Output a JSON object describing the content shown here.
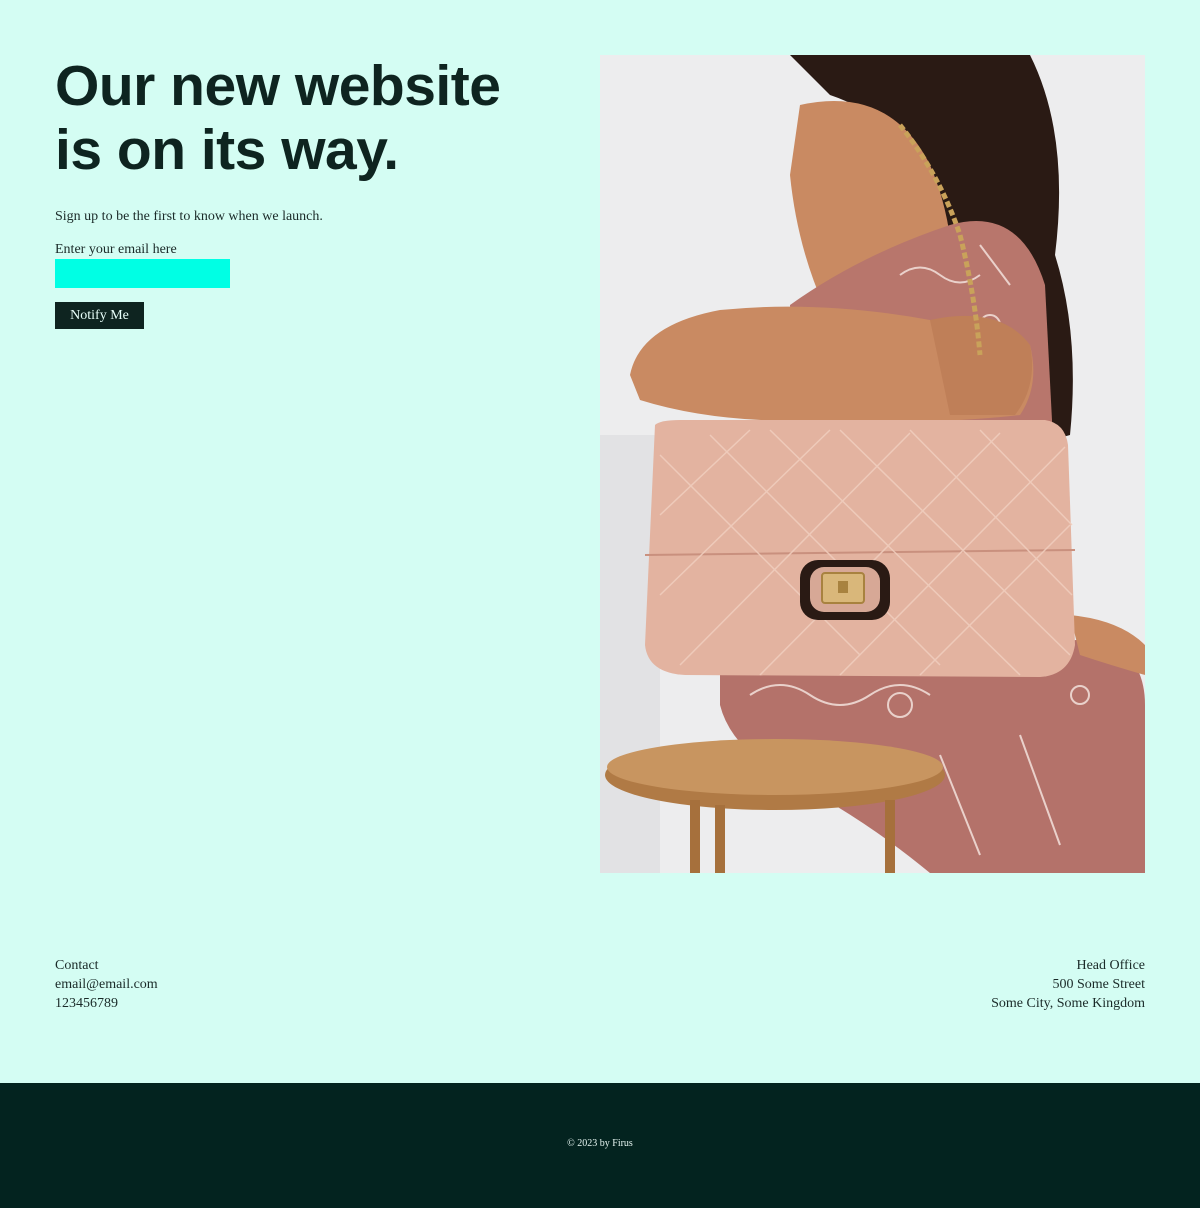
{
  "hero": {
    "title_line1": "Our new website",
    "title_line2": "is on its way.",
    "subtitle": "Sign up to be the first to know when we launch."
  },
  "signup": {
    "email_label": "Enter your email here",
    "email_value": "",
    "button_label": "Notify Me"
  },
  "photo": {
    "icon": "product-photo-woman-with-quilted-handbag"
  },
  "contact": {
    "heading": "Contact",
    "email": "email@email.com",
    "phone": "123456789"
  },
  "office": {
    "heading": "Head Office",
    "street": "500 Some Street",
    "city": "Some City, Some Kingdom"
  },
  "footer": {
    "copyright": "© 2023 by Firus"
  },
  "colors": {
    "background": "#d4fdf3",
    "accent_input": "#00ffe4",
    "dark": "#0e2420",
    "footer": "#03231f"
  }
}
